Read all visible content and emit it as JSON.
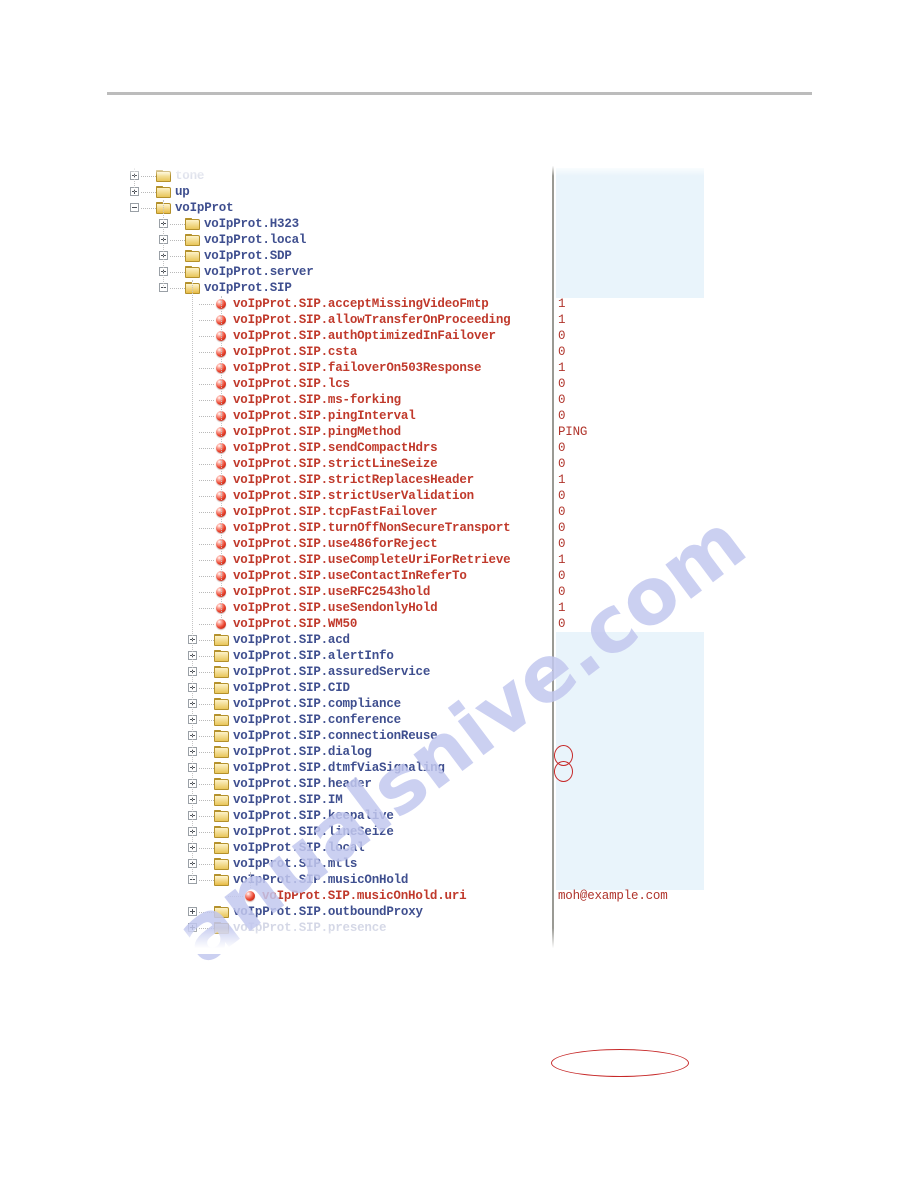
{
  "page": {
    "divider_color": "#bcbcbc",
    "watermark_text": "anualsnive.com"
  },
  "tree": {
    "column_divider_x": "553",
    "rows": [
      {
        "label": "tone",
        "type": "folder",
        "indent": 0,
        "expander": "plus",
        "state": "dim2",
        "value": ""
      },
      {
        "label": "up",
        "type": "folder",
        "indent": 0,
        "expander": "plus",
        "state": "normal",
        "value": ""
      },
      {
        "label": "voIpProt",
        "type": "folder",
        "indent": 0,
        "expander": "minus",
        "state": "normal",
        "value": ""
      },
      {
        "label": "voIpProt.H323",
        "type": "folder",
        "indent": 1,
        "expander": "plus",
        "state": "normal",
        "value": ""
      },
      {
        "label": "voIpProt.local",
        "type": "folder",
        "indent": 1,
        "expander": "plus",
        "state": "normal",
        "value": ""
      },
      {
        "label": "voIpProt.SDP",
        "type": "folder",
        "indent": 1,
        "expander": "plus",
        "state": "normal",
        "value": ""
      },
      {
        "label": "voIpProt.server",
        "type": "folder",
        "indent": 1,
        "expander": "plus",
        "state": "normal",
        "value": ""
      },
      {
        "label": "voIpProt.SIP",
        "type": "folder",
        "indent": 1,
        "expander": "minus",
        "state": "normal",
        "value": ""
      },
      {
        "label": "voIpProt.SIP.acceptMissingVideoFmtp",
        "type": "leaf",
        "indent": 2,
        "expander": "none",
        "state": "normal",
        "value": "1"
      },
      {
        "label": "voIpProt.SIP.allowTransferOnProceeding",
        "type": "leaf",
        "indent": 2,
        "expander": "none",
        "state": "normal",
        "value": "1"
      },
      {
        "label": "voIpProt.SIP.authOptimizedInFailover",
        "type": "leaf",
        "indent": 2,
        "expander": "none",
        "state": "normal",
        "value": "0"
      },
      {
        "label": "voIpProt.SIP.csta",
        "type": "leaf",
        "indent": 2,
        "expander": "none",
        "state": "normal",
        "value": "0"
      },
      {
        "label": "voIpProt.SIP.failoverOn503Response",
        "type": "leaf",
        "indent": 2,
        "expander": "none",
        "state": "normal",
        "value": "1"
      },
      {
        "label": "voIpProt.SIP.lcs",
        "type": "leaf",
        "indent": 2,
        "expander": "none",
        "state": "normal",
        "value": "0"
      },
      {
        "label": "voIpProt.SIP.ms-forking",
        "type": "leaf",
        "indent": 2,
        "expander": "none",
        "state": "normal",
        "value": "0"
      },
      {
        "label": "voIpProt.SIP.pingInterval",
        "type": "leaf",
        "indent": 2,
        "expander": "none",
        "state": "normal",
        "value": "0"
      },
      {
        "label": "voIpProt.SIP.pingMethod",
        "type": "leaf",
        "indent": 2,
        "expander": "none",
        "state": "normal",
        "value": "PING"
      },
      {
        "label": "voIpProt.SIP.sendCompactHdrs",
        "type": "leaf",
        "indent": 2,
        "expander": "none",
        "state": "normal",
        "value": "0"
      },
      {
        "label": "voIpProt.SIP.strictLineSeize",
        "type": "leaf",
        "indent": 2,
        "expander": "none",
        "state": "normal",
        "value": "0"
      },
      {
        "label": "voIpProt.SIP.strictReplacesHeader",
        "type": "leaf",
        "indent": 2,
        "expander": "none",
        "state": "normal",
        "value": "1"
      },
      {
        "label": "voIpProt.SIP.strictUserValidation",
        "type": "leaf",
        "indent": 2,
        "expander": "none",
        "state": "normal",
        "value": "0"
      },
      {
        "label": "voIpProt.SIP.tcpFastFailover",
        "type": "leaf",
        "indent": 2,
        "expander": "none",
        "state": "normal",
        "value": "0"
      },
      {
        "label": "voIpProt.SIP.turnOffNonSecureTransport",
        "type": "leaf",
        "indent": 2,
        "expander": "none",
        "state": "normal",
        "value": "0"
      },
      {
        "label": "voIpProt.SIP.use486forReject",
        "type": "leaf",
        "indent": 2,
        "expander": "none",
        "state": "normal",
        "value": "0"
      },
      {
        "label": "voIpProt.SIP.useCompleteUriForRetrieve",
        "type": "leaf",
        "indent": 2,
        "expander": "none",
        "state": "normal",
        "value": "1"
      },
      {
        "label": "voIpProt.SIP.useContactInReferTo",
        "type": "leaf",
        "indent": 2,
        "expander": "none",
        "state": "normal",
        "value": "0"
      },
      {
        "label": "voIpProt.SIP.useRFC2543hold",
        "type": "leaf",
        "indent": 2,
        "expander": "none",
        "state": "normal",
        "value": "0"
      },
      {
        "label": "voIpProt.SIP.useSendonlyHold",
        "type": "leaf",
        "indent": 2,
        "expander": "none",
        "state": "normal",
        "value": "1"
      },
      {
        "label": "voIpProt.SIP.WM50",
        "type": "leaf",
        "indent": 2,
        "expander": "none",
        "state": "normal",
        "value": "0"
      },
      {
        "label": "voIpProt.SIP.acd",
        "type": "folder",
        "indent": 2,
        "expander": "plus",
        "state": "normal",
        "value": ""
      },
      {
        "label": "voIpProt.SIP.alertInfo",
        "type": "folder",
        "indent": 2,
        "expander": "plus",
        "state": "normal",
        "value": ""
      },
      {
        "label": "voIpProt.SIP.assuredService",
        "type": "folder",
        "indent": 2,
        "expander": "plus",
        "state": "normal",
        "value": ""
      },
      {
        "label": "voIpProt.SIP.CID",
        "type": "folder",
        "indent": 2,
        "expander": "plus",
        "state": "normal",
        "value": ""
      },
      {
        "label": "voIpProt.SIP.compliance",
        "type": "folder",
        "indent": 2,
        "expander": "plus",
        "state": "normal",
        "value": ""
      },
      {
        "label": "voIpProt.SIP.conference",
        "type": "folder",
        "indent": 2,
        "expander": "plus",
        "state": "normal",
        "value": ""
      },
      {
        "label": "voIpProt.SIP.connectionReuse",
        "type": "folder",
        "indent": 2,
        "expander": "plus",
        "state": "normal",
        "value": ""
      },
      {
        "label": "voIpProt.SIP.dialog",
        "type": "folder",
        "indent": 2,
        "expander": "plus",
        "state": "normal",
        "value": ""
      },
      {
        "label": "voIpProt.SIP.dtmfViaSignaling",
        "type": "folder",
        "indent": 2,
        "expander": "plus",
        "state": "normal",
        "value": ""
      },
      {
        "label": "voIpProt.SIP.header",
        "type": "folder",
        "indent": 2,
        "expander": "plus",
        "state": "normal",
        "value": ""
      },
      {
        "label": "voIpProt.SIP.IM",
        "type": "folder",
        "indent": 2,
        "expander": "plus",
        "state": "normal",
        "value": ""
      },
      {
        "label": "voIpProt.SIP.keepalive",
        "type": "folder",
        "indent": 2,
        "expander": "plus",
        "state": "normal",
        "value": ""
      },
      {
        "label": "voIpProt.SIP.lineSeize",
        "type": "folder",
        "indent": 2,
        "expander": "plus",
        "state": "normal",
        "value": ""
      },
      {
        "label": "voIpProt.SIP.local",
        "type": "folder",
        "indent": 2,
        "expander": "plus",
        "state": "normal",
        "value": ""
      },
      {
        "label": "voIpProt.SIP.mtls",
        "type": "folder",
        "indent": 2,
        "expander": "plus",
        "state": "normal",
        "value": ""
      },
      {
        "label": "voIpProt.SIP.musicOnHold",
        "type": "folder",
        "indent": 2,
        "expander": "minus",
        "state": "normal",
        "value": ""
      },
      {
        "label": "voIpProt.SIP.musicOnHold.uri",
        "type": "leaf",
        "indent": 3,
        "expander": "none",
        "state": "normal",
        "value": "moh@example.com"
      },
      {
        "label": "voIpProt.SIP.outboundProxy",
        "type": "folder",
        "indent": 2,
        "expander": "plus",
        "state": "normal",
        "value": ""
      },
      {
        "label": "voIpProt.SIP.presence",
        "type": "folder",
        "indent": 2,
        "expander": "plus",
        "state": "dim",
        "value": ""
      }
    ]
  },
  "annotations": {
    "color": "#c62828",
    "items": [
      {
        "target": "voIpProt.SIP.useRFC2543hold",
        "circled_value": "0"
      },
      {
        "target": "voIpProt.SIP.useSendonlyHold",
        "circled_value": "1"
      },
      {
        "target": "voIpProt.SIP.musicOnHold.uri",
        "circled_value": "moh@example.com"
      }
    ]
  }
}
